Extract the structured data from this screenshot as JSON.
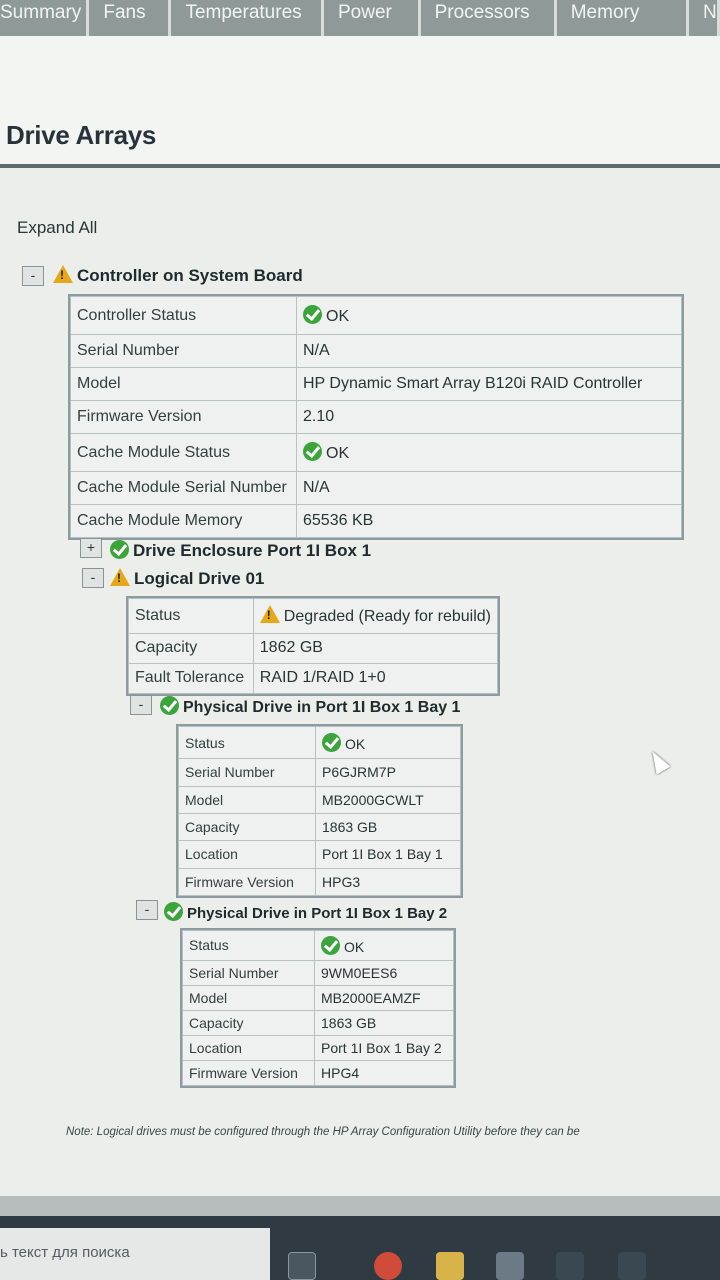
{
  "tabs": [
    "Summary",
    "Fans",
    "Temperatures",
    "Power",
    "Processors",
    "Memory",
    "N"
  ],
  "page_title": "Drive Arrays",
  "expand_all": "Expand All",
  "controller": {
    "toggle": "-",
    "title": "Controller on System Board",
    "rows": [
      {
        "label": "Controller Status",
        "value": "OK",
        "ok": true
      },
      {
        "label": "Serial Number",
        "value": "N/A"
      },
      {
        "label": "Model",
        "value": "HP Dynamic Smart Array B120i RAID Controller"
      },
      {
        "label": "Firmware Version",
        "value": "2.10"
      },
      {
        "label": "Cache Module Status",
        "value": "OK",
        "ok": true
      },
      {
        "label": "Cache Module Serial Number",
        "value": "N/A"
      },
      {
        "label": "Cache Module Memory",
        "value": "65536 KB"
      }
    ]
  },
  "enclosure": {
    "toggle": "+",
    "title": "Drive Enclosure Port 1I Box 1"
  },
  "logical_drive": {
    "toggle": "-",
    "title": "Logical Drive 01",
    "rows": [
      {
        "label": "Status",
        "value": "Degraded (Ready for rebuild)",
        "warn": true
      },
      {
        "label": "Capacity",
        "value": "1862 GB"
      },
      {
        "label": "Fault Tolerance",
        "value": "RAID 1/RAID 1+0"
      }
    ]
  },
  "physical_drive_1": {
    "toggle": "-",
    "title": "Physical Drive in Port 1I Box 1 Bay 1",
    "rows": [
      {
        "label": "Status",
        "value": "OK",
        "ok": true
      },
      {
        "label": "Serial Number",
        "value": "P6GJRM7P"
      },
      {
        "label": "Model",
        "value": "MB2000GCWLT"
      },
      {
        "label": "Capacity",
        "value": "1863 GB"
      },
      {
        "label": "Location",
        "value": "Port 1I Box 1 Bay 1"
      },
      {
        "label": "Firmware Version",
        "value": "HPG3"
      }
    ]
  },
  "physical_drive_2": {
    "toggle": "-",
    "title": "Physical Drive in Port 1I Box 1 Bay 2",
    "rows": [
      {
        "label": "Status",
        "value": "OK",
        "ok": true
      },
      {
        "label": "Serial Number",
        "value": "9WM0EES6"
      },
      {
        "label": "Model",
        "value": "MB2000EAMZF"
      },
      {
        "label": "Capacity",
        "value": "1863 GB"
      },
      {
        "label": "Location",
        "value": "Port 1I Box 1 Bay 2"
      },
      {
        "label": "Firmware Version",
        "value": "HPG4"
      }
    ]
  },
  "note": "Note: Logical drives must be configured through the HP Array Configuration Utility before they can be",
  "taskbar": {
    "search_placeholder": "ь текст для поиска"
  }
}
